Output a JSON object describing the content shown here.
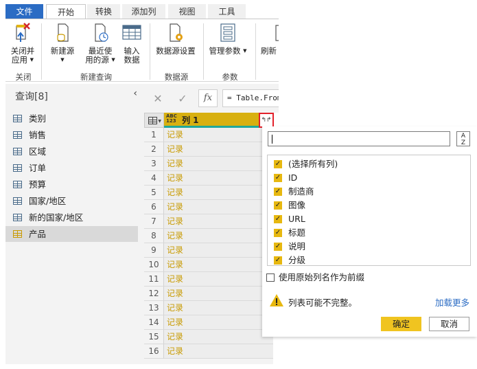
{
  "ribbon": {
    "tabs": [
      "文件",
      "开始",
      "转换",
      "添加列",
      "视图",
      "工具"
    ],
    "active_tab": "开始",
    "buttons": {
      "close_apply": [
        "关闭并",
        "应用"
      ],
      "new_source": "新建源",
      "recent_sources": [
        "最近使",
        "用的源"
      ],
      "enter_data": [
        "输入",
        "数据"
      ],
      "data_source_settings": "数据源设置",
      "manage_params": "管理参数",
      "refresh": "刷新"
    },
    "groups": {
      "close": "关闭",
      "new_query": "新建查询",
      "data_sources": "数据源",
      "parameters": "参数"
    }
  },
  "queries": {
    "header": "查询[8]",
    "items": [
      "类别",
      "销售",
      "区域",
      "订单",
      "预算",
      "国家/地区",
      "新的国家/地区",
      "产品"
    ],
    "selected": "产品"
  },
  "formula_bar": {
    "cancel": "✕",
    "commit": "✓",
    "fx": "fx",
    "text": "= Table.From"
  },
  "grid": {
    "column_type": [
      "ABC",
      "123"
    ],
    "column_name": "列 1",
    "rows": [
      "1",
      "2",
      "3",
      "4",
      "5",
      "6",
      "7",
      "8",
      "9",
      "10",
      "11",
      "12",
      "13",
      "14",
      "15",
      "16"
    ],
    "cell_value": "记录"
  },
  "expand_panel": {
    "search_value": "",
    "sort_icon": [
      "A",
      "Z"
    ],
    "columns": [
      "(选择所有列)",
      "ID",
      "制造商",
      "图像",
      "URL",
      "标题",
      "说明",
      "分级"
    ],
    "checked": [
      true,
      true,
      true,
      true,
      true,
      true,
      true,
      true
    ],
    "use_prefix_label": "使用原始列名作为前缀",
    "use_prefix_checked": false,
    "warning": "列表可能不完整。",
    "load_more": "加载更多",
    "ok": "确定",
    "cancel": "取消"
  },
  "colors": {
    "file_tab": "#2b6cc4",
    "accent_yellow": "#e7b810",
    "column_header": "#d8b010",
    "column_underline": "#20a79a",
    "highlight_border": "#e3202a",
    "record_text": "#c89a00"
  }
}
